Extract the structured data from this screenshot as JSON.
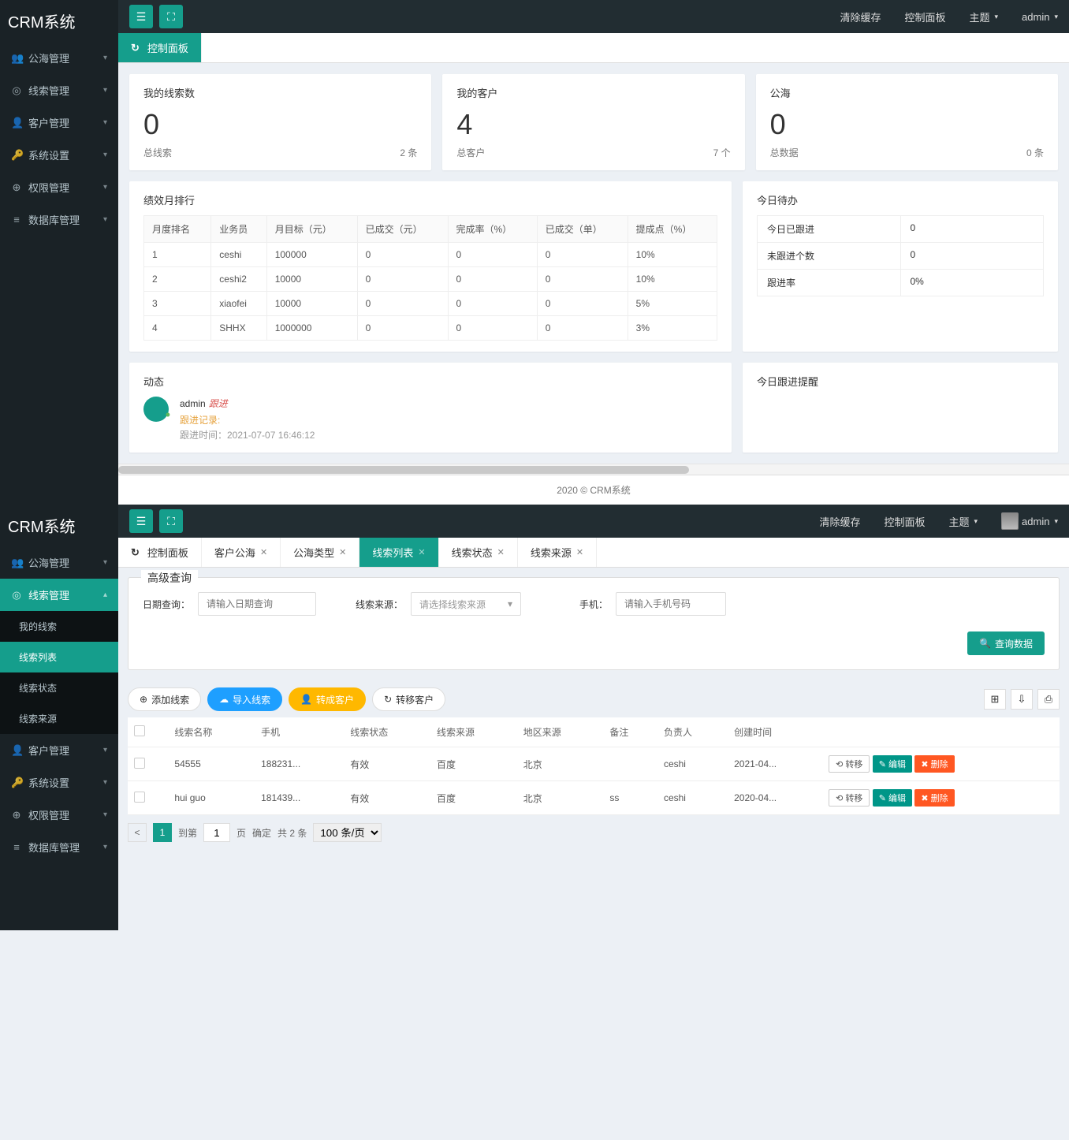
{
  "brand": "CRM系统",
  "topnav": {
    "clear_cache": "清除缓存",
    "control_panel": "控制面板",
    "theme": "主题",
    "user": "admin"
  },
  "sidebar": [
    {
      "label": "公海管理",
      "icon": "👥"
    },
    {
      "label": "线索管理",
      "icon": "◎"
    },
    {
      "label": "客户管理",
      "icon": "👤"
    },
    {
      "label": "系统设置",
      "icon": "🔑"
    },
    {
      "label": "权限管理",
      "icon": "⊕"
    },
    {
      "label": "数据库管理",
      "icon": "≡"
    }
  ],
  "sidebar2_open_children": [
    {
      "label": "我的线索"
    },
    {
      "label": "线索列表",
      "active": true
    },
    {
      "label": "线索状态"
    },
    {
      "label": "线索来源"
    }
  ],
  "panel1": {
    "tab_home": "控制面板",
    "stat_cards": [
      {
        "title": "我的线索数",
        "value": "0",
        "footer_label": "总线索",
        "footer_value": "2 条"
      },
      {
        "title": "我的客户",
        "value": "4",
        "footer_label": "总客户",
        "footer_value": "7 个"
      },
      {
        "title": "公海",
        "value": "0",
        "footer_label": "总数据",
        "footer_value": "0 条"
      }
    ],
    "rank_title": "绩效月排行",
    "rank_headers": [
      "月度排名",
      "业务员",
      "月目标（元）",
      "已成交（元）",
      "完成率（%）",
      "已成交（单）",
      "提成点（%）"
    ],
    "rank_rows": [
      [
        "1",
        "ceshi",
        "100000",
        "0",
        "0",
        "0",
        "10%"
      ],
      [
        "2",
        "ceshi2",
        "10000",
        "0",
        "0",
        "0",
        "10%"
      ],
      [
        "3",
        "xiaofei",
        "10000",
        "0",
        "0",
        "0",
        "5%"
      ],
      [
        "4",
        "SHHX",
        "1000000",
        "0",
        "0",
        "0",
        "3%"
      ]
    ],
    "todo_title": "今日待办",
    "todo_rows": [
      {
        "k": "今日已跟进",
        "v": "0"
      },
      {
        "k": "未跟进个数",
        "v": "0"
      },
      {
        "k": "跟进率",
        "v": "0%"
      }
    ],
    "activity_title": "动态",
    "activity_user": "admin",
    "activity_tag": "跟进",
    "activity_label": "跟进记录:",
    "activity_time": "跟进时间：2021-07-07 16:46:12",
    "remind_title": "今日跟进提醒",
    "footer": "2020 ©   CRM系统"
  },
  "panel2": {
    "tabs": [
      {
        "label": "控制面板",
        "home": true
      },
      {
        "label": "客户公海",
        "closable": true
      },
      {
        "label": "公海类型",
        "closable": true
      },
      {
        "label": "线索列表",
        "closable": true,
        "active": true
      },
      {
        "label": "线索状态",
        "closable": true
      },
      {
        "label": "线索来源",
        "closable": true
      }
    ],
    "adv_search_title": "高级查询",
    "filters": {
      "date_label": "日期查询：",
      "date_placeholder": "请输入日期查询",
      "source_label": "线索来源：",
      "source_placeholder": "请选择线索来源",
      "phone_label": "手机：",
      "phone_placeholder": "请输入手机号码"
    },
    "search_btn": "查询数据",
    "action_buttons": {
      "add": "添加线索",
      "import": "导入线索",
      "transfer_customer": "转成客户",
      "move_customer": "转移客户"
    },
    "columns": [
      "",
      "线索名称",
      "手机",
      "线索状态",
      "线索来源",
      "地区来源",
      "备注",
      "负责人",
      "创建时间",
      ""
    ],
    "rows": [
      {
        "name": "54555",
        "phone": "188231...",
        "status": "有效",
        "source": "百度",
        "region": "北京",
        "remark": "",
        "owner": "ceshi",
        "created": "2021-04..."
      },
      {
        "name": "hui guo",
        "phone": "181439...",
        "status": "有效",
        "source": "百度",
        "region": "北京",
        "remark": "ss",
        "owner": "ceshi",
        "created": "2020-04..."
      }
    ],
    "row_actions": {
      "move": "转移",
      "edit": "编辑",
      "del": "删除"
    },
    "pager": {
      "prev": "<",
      "page": "1",
      "to_page_label": "到第",
      "page_input": "1",
      "page_unit": "页",
      "confirm": "确定",
      "total": "共 2 条",
      "per_page": "100 条/页"
    }
  }
}
